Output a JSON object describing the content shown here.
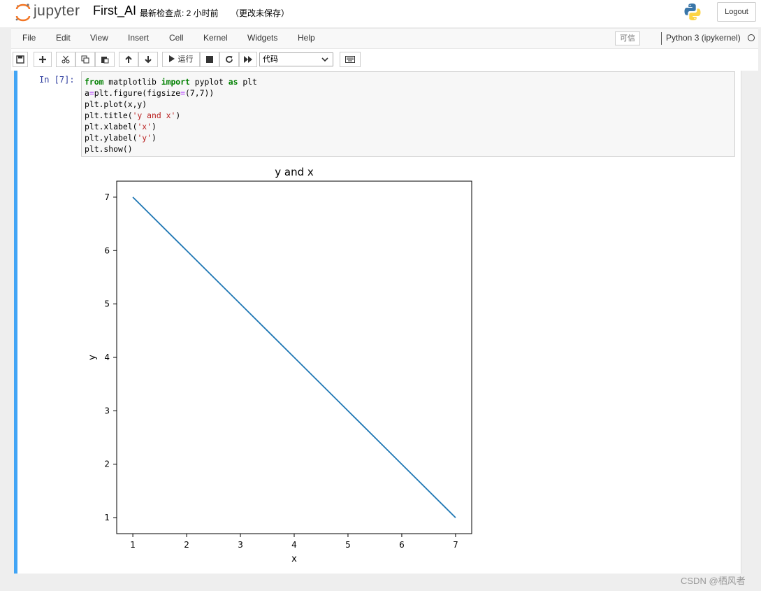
{
  "header": {
    "logo_text": "jupyter",
    "notebook_name": "First_AI",
    "checkpoint": "最新检查点: 2 小时前",
    "autosave": "（更改未保存）",
    "logout_label": "Logout"
  },
  "menubar": {
    "items": [
      "File",
      "Edit",
      "View",
      "Insert",
      "Cell",
      "Kernel",
      "Widgets",
      "Help"
    ],
    "trusted_label": "可信",
    "kernel_name": "Python 3 (ipykernel)"
  },
  "toolbar": {
    "run_label": "运行",
    "cell_type": "代码",
    "icons": [
      "save-icon",
      "plus-icon",
      "cut-icon",
      "copy-icon",
      "paste-icon",
      "arrow-up-icon",
      "arrow-down-icon",
      "run-icon",
      "stop-icon",
      "restart-icon",
      "fast-forward-icon",
      "keyboard-icon"
    ]
  },
  "cell": {
    "prompt": "In  [7]:"
  },
  "chart_data": {
    "type": "line",
    "title": "y and x",
    "xlabel": "x",
    "ylabel": "y",
    "xlim": [
      0.7,
      7.3
    ],
    "ylim": [
      0.7,
      7.3
    ],
    "xticks": [
      1,
      2,
      3,
      4,
      5,
      6,
      7
    ],
    "yticks": [
      1,
      2,
      3,
      4,
      5,
      6,
      7
    ],
    "grid": false,
    "series": [
      {
        "x": [
          1,
          2,
          3,
          4,
          5,
          6,
          7
        ],
        "y": [
          7,
          6,
          5,
          4,
          3,
          2,
          1
        ],
        "color": "#1f77b4"
      }
    ]
  },
  "watermark": "CSDN @栖风者"
}
